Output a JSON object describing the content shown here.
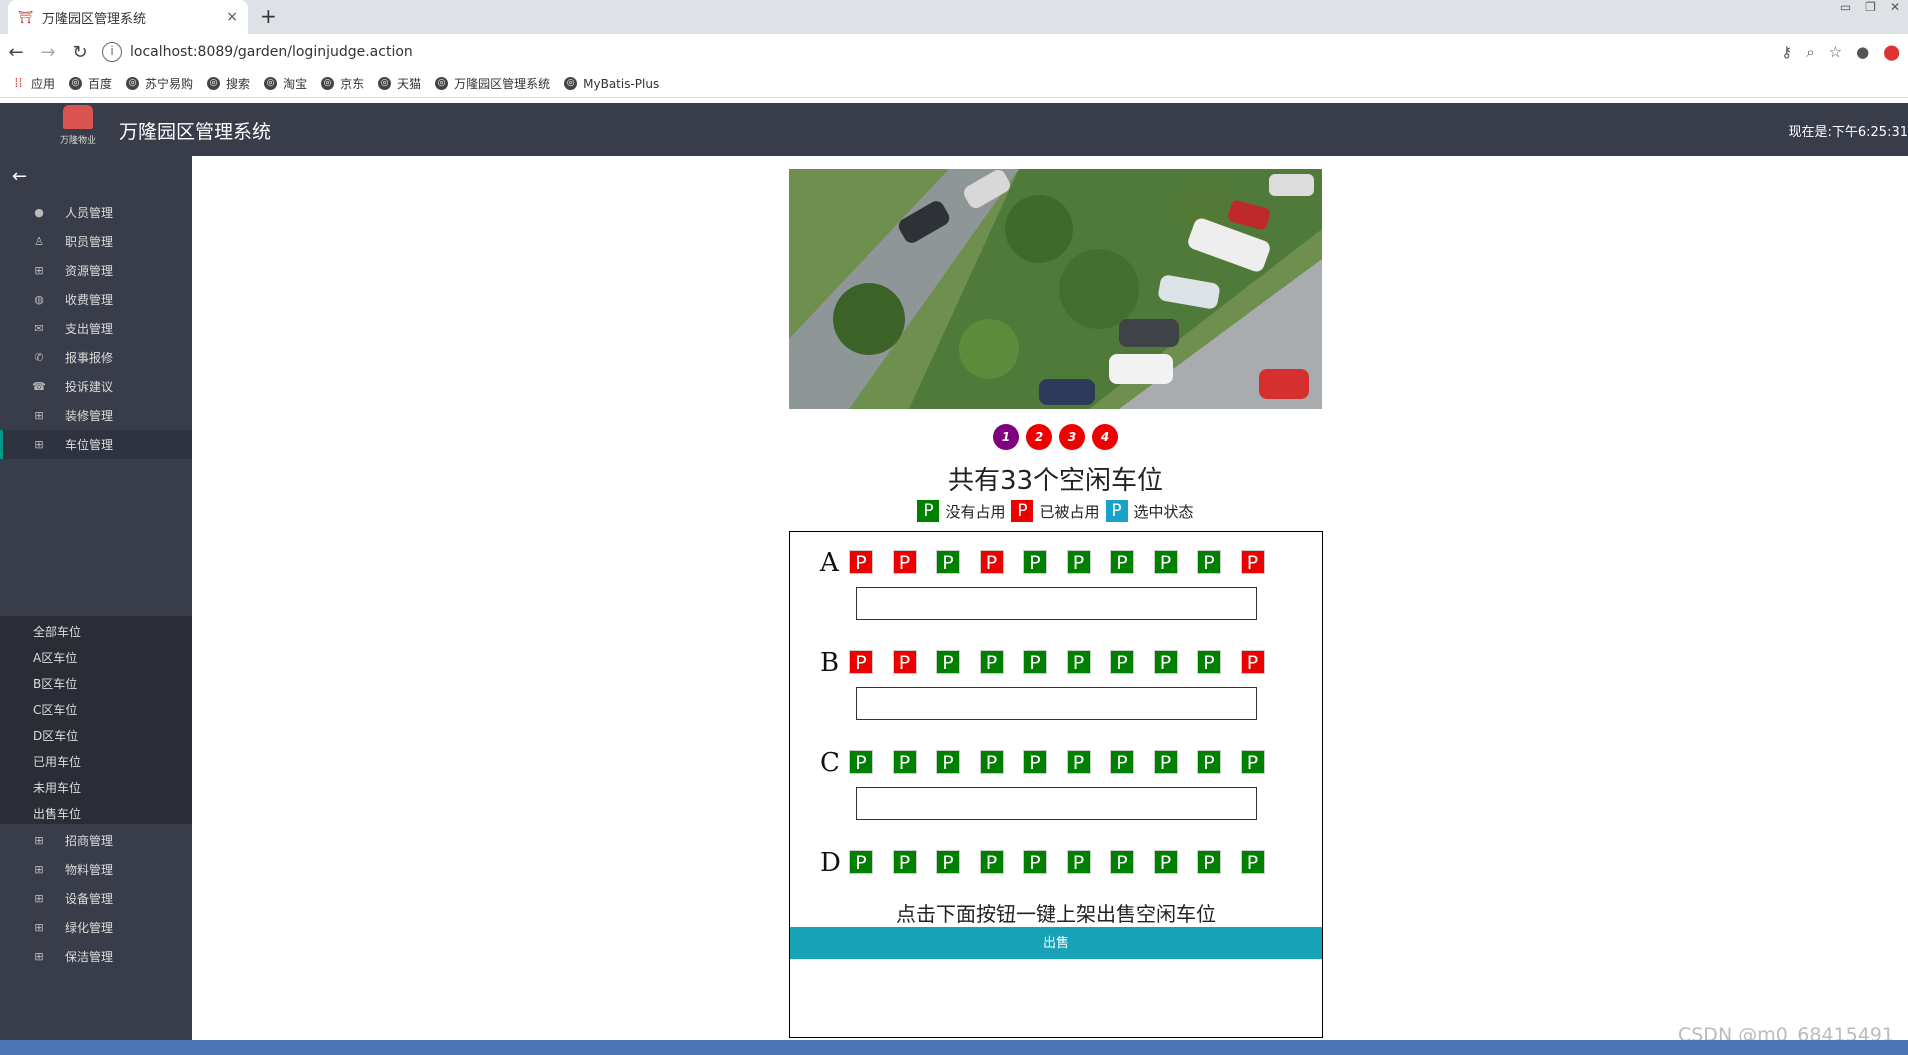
{
  "browser": {
    "tab_title": "万隆园区管理系统",
    "new_tab": "+",
    "close_tab": "×",
    "url": "localhost:8089/garden/loginjudge.action",
    "bookmarks": [
      "应用",
      "百度",
      "苏宁易购",
      "搜索",
      "淘宝",
      "京东",
      "天猫",
      "万隆园区管理系统",
      "MyBatis-Plus"
    ]
  },
  "app": {
    "title": "万隆园区管理系统",
    "logo_caption": "万隆物业",
    "clock": "现在是:下午6:25:31"
  },
  "sidebar": {
    "back_icon": "←",
    "items": [
      "人员管理",
      "职员管理",
      "资源管理",
      "收费管理",
      "支出管理",
      "报事报修",
      "投诉建议",
      "装修管理",
      "车位管理"
    ],
    "sub_items": [
      "全部车位",
      "A区车位",
      "B区车位",
      "C区车位",
      "D区车位",
      "已用车位",
      "未用车位",
      "出售车位"
    ],
    "items_after": [
      "招商管理",
      "物料管理",
      "设备管理",
      "绿化管理",
      "保洁管理"
    ]
  },
  "carousel": {
    "dots": [
      "1",
      "2",
      "3",
      "4"
    ],
    "selected": 0
  },
  "parking": {
    "free_count_text": "共有33个空闲车位",
    "legend": {
      "free": "没有占用",
      "used": "已被占用",
      "selected": "选中状态",
      "symbol": "P"
    },
    "rows": [
      {
        "label": "A",
        "spots": [
          "used",
          "used",
          "free",
          "used",
          "free",
          "free",
          "free",
          "free",
          "free",
          "used"
        ]
      },
      {
        "label": "B",
        "spots": [
          "used",
          "used",
          "free",
          "free",
          "free",
          "free",
          "free",
          "free",
          "free",
          "used"
        ]
      },
      {
        "label": "C",
        "spots": [
          "free",
          "free",
          "free",
          "free",
          "free",
          "free",
          "free",
          "free",
          "free",
          "free"
        ]
      },
      {
        "label": "D",
        "spots": [
          "free",
          "free",
          "free",
          "free",
          "free",
          "free",
          "free",
          "free",
          "free",
          "free"
        ]
      }
    ],
    "sell_hint": "点击下面按钮一键上架出售空闲车位",
    "sell_button": "出售"
  },
  "watermark": "CSDN @m0_68415491",
  "colors": {
    "free": "#008000",
    "used": "#e00000",
    "selected": "#17a2c8",
    "header": "#393d49",
    "button": "#17a2b8"
  }
}
